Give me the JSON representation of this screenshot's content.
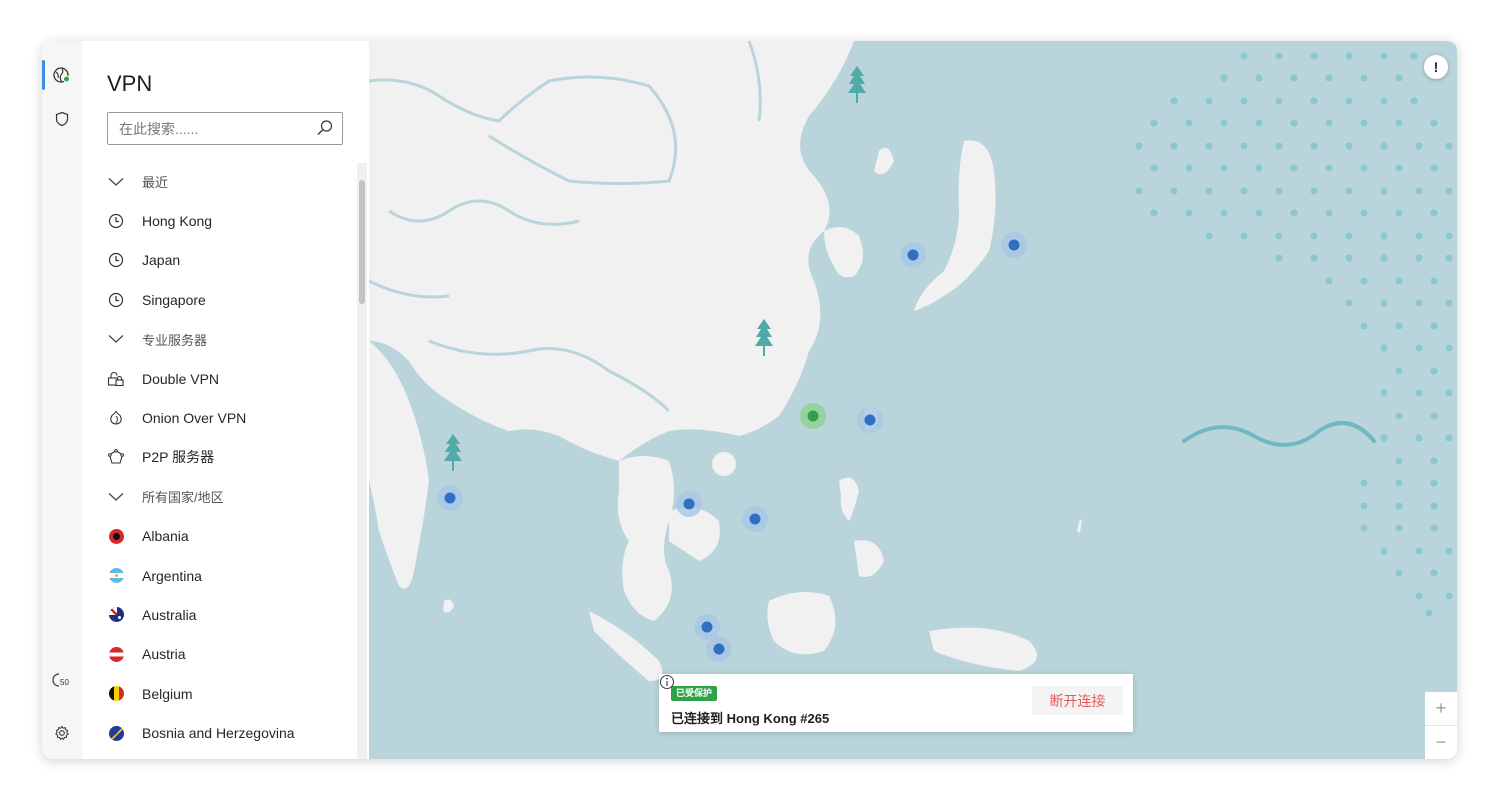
{
  "rail": {
    "icons": [
      "globe-vpn-icon",
      "shield-icon",
      "meshnet-icon",
      "settings-icon"
    ]
  },
  "sidebar": {
    "title": "VPN",
    "search_placeholder": "在此搜索......",
    "sections": {
      "recent": {
        "label": "最近",
        "items": [
          "Hong Kong",
          "Japan",
          "Singapore"
        ]
      },
      "specialty": {
        "label": "专业服务器",
        "items": [
          "Double VPN",
          "Onion Over VPN",
          "P2P 服务器"
        ]
      },
      "countries": {
        "label": "所有国家/地区",
        "items": [
          "Albania",
          "Argentina",
          "Australia",
          "Austria",
          "Belgium",
          "Bosnia and Herzegovina"
        ]
      }
    }
  },
  "status": {
    "badge": "已受保护",
    "connected_text": "已连接到 Hong Kong #265",
    "disconnect_label": "断开连接"
  },
  "map_controls": {
    "alert": "!",
    "zoom_in": "+",
    "zoom_out": "−"
  },
  "colors": {
    "accent": "#3c8be0",
    "protected": "#2fa34a",
    "disconnect": "#e35a5a",
    "ocean": "#b9d4da",
    "land": "#f1f1f1",
    "server_pin": "#2f6fc4"
  }
}
